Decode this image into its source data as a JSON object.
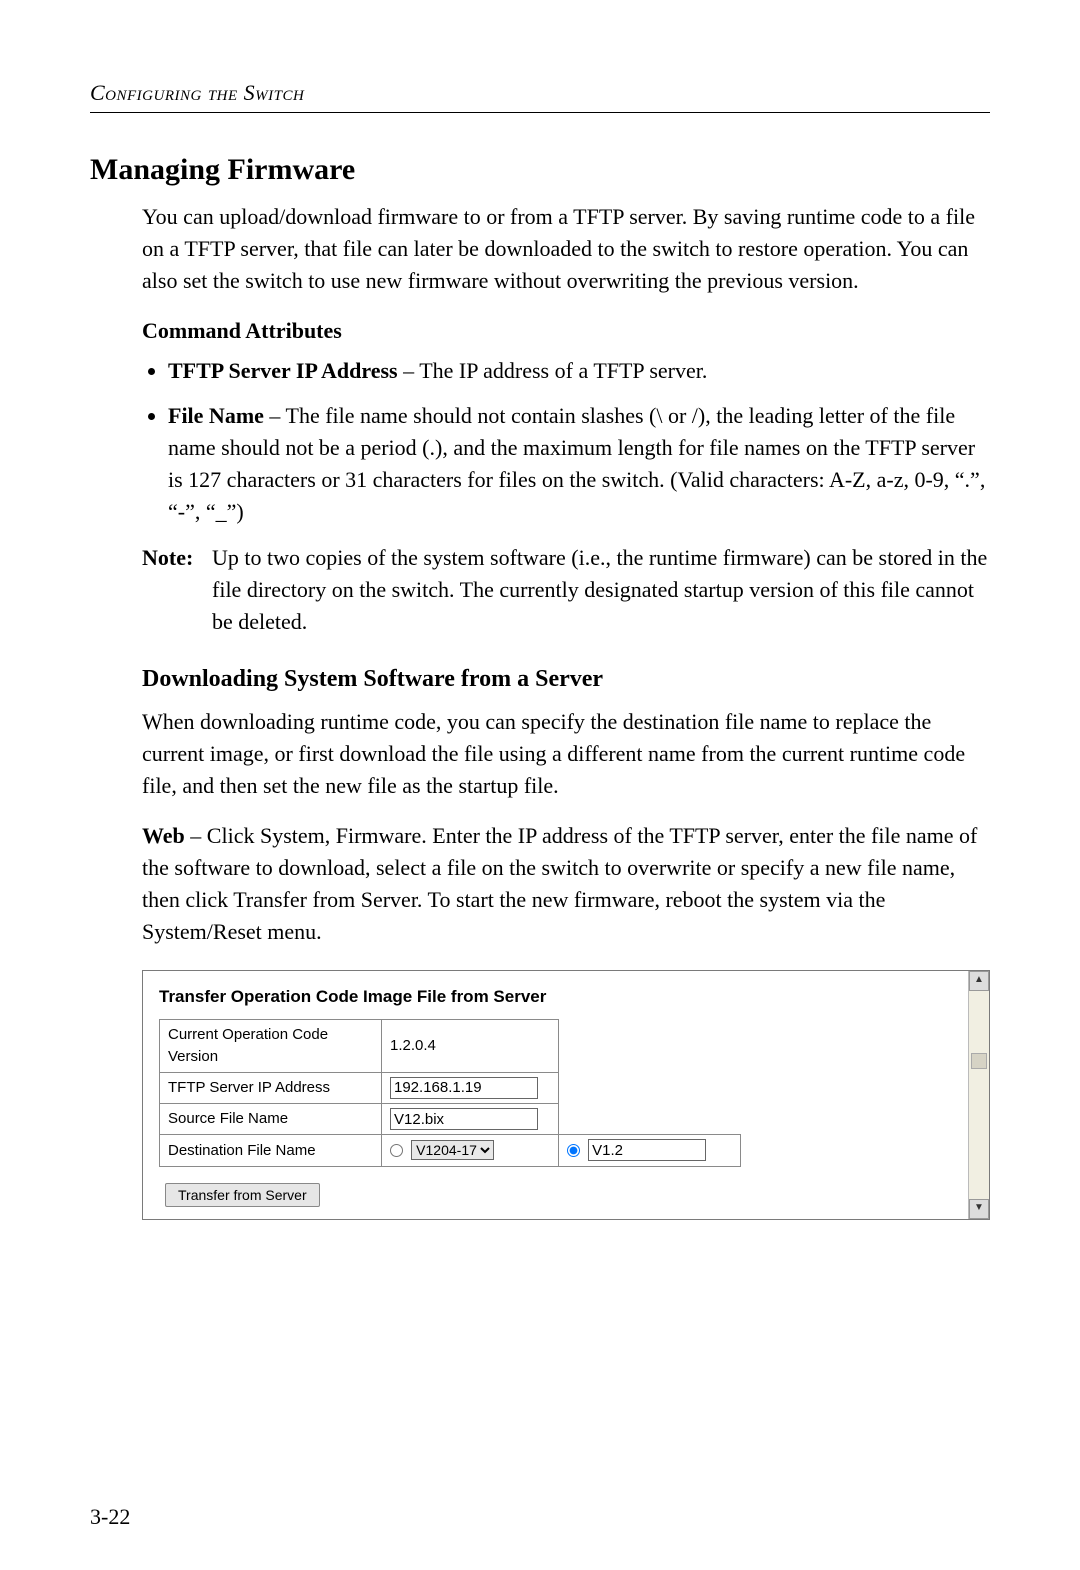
{
  "running_head": "Configuring the Switch",
  "section_title": "Managing Firmware",
  "intro": "You can upload/download firmware to or from a TFTP server. By saving runtime code to a file on a TFTP server, that file can later be downloaded to the switch to restore operation. You can also set the switch to use new firmware without overwriting the previous version.",
  "cmd_attr_heading": "Command Attributes",
  "attrs": {
    "tftp": {
      "label": "TFTP Server IP Address",
      "text": " – The IP address of a TFTP server."
    },
    "file": {
      "label": "File Name",
      "text": " – The file name should not contain slashes (\\ or /), the leading letter of the file name should not be a period (.), and the maximum length for file names on the TFTP server is 127 characters or 31 characters for files on the switch. (Valid characters: A-Z, a-z, 0-9, “.”, “-”, “_”)"
    }
  },
  "note": {
    "label": "Note:",
    "text": "Up to two copies of the system software (i.e., the runtime firmware) can be stored in the file directory on the switch. The currently designated startup version of this file cannot be deleted."
  },
  "subsection_title": "Downloading System Software from a Server",
  "p_download_1": "When downloading runtime code, you can specify the destination file name to replace the current image, or first download the file using a different name from the current runtime code file, and then set the new file as the startup file.",
  "p_download_2_label": "Web",
  "p_download_2_text": " – Click System, Firmware. Enter the IP address of the TFTP server, enter the file name of the software to download, select a file on the switch to overwrite or specify a new file name, then click Transfer from Server. To start the new firmware, reboot the system via the System/Reset menu.",
  "shot": {
    "title": "Transfer Operation Code Image File from Server",
    "rows": {
      "cur_ver": {
        "label": "Current Operation Code Version",
        "value": "1.2.0.4"
      },
      "ip": {
        "label": "TFTP Server IP Address",
        "value": "192.168.1.19"
      },
      "src": {
        "label": "Source File Name",
        "value": "V12.bix"
      },
      "dest": {
        "label": "Destination File Name",
        "select": "V1204-17",
        "new_value": "V1.2"
      }
    },
    "button": "Transfer from Server"
  },
  "page_number": "3-22"
}
